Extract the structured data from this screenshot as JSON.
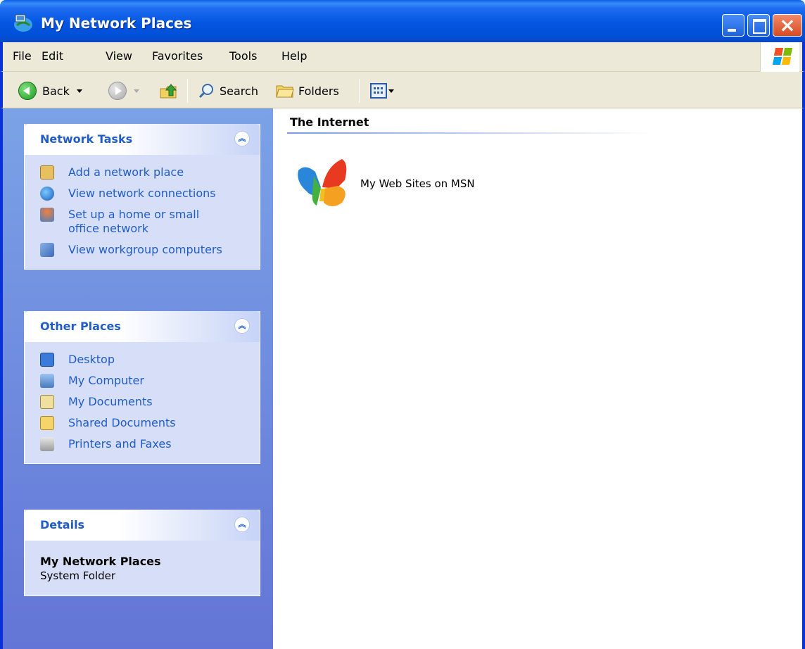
{
  "window": {
    "title": "My Network Places"
  },
  "menu": {
    "items": [
      "File",
      "Edit",
      "View",
      "Favorites",
      "Tools",
      "Help"
    ]
  },
  "toolbar": {
    "back_label": "Back",
    "search_label": "Search",
    "folders_label": "Folders"
  },
  "sidebar": {
    "network_tasks": {
      "title": "Network Tasks",
      "items": [
        {
          "label": "Add a network place",
          "icon": "add-network-place-icon"
        },
        {
          "label": "View network connections",
          "icon": "network-connections-icon"
        },
        {
          "label": "Set up a home or small office network",
          "icon": "home-network-icon"
        },
        {
          "label": "View workgroup computers",
          "icon": "workgroup-icon"
        }
      ]
    },
    "other_places": {
      "title": "Other Places",
      "items": [
        {
          "label": "Desktop",
          "icon": "desktop-icon"
        },
        {
          "label": "My Computer",
          "icon": "my-computer-icon"
        },
        {
          "label": "My Documents",
          "icon": "my-documents-icon"
        },
        {
          "label": "Shared Documents",
          "icon": "shared-documents-icon"
        },
        {
          "label": "Printers and Faxes",
          "icon": "printers-icon"
        }
      ]
    },
    "details": {
      "title": "Details",
      "name": "My Network Places",
      "type": "System Folder"
    }
  },
  "main": {
    "group_title": "The Internet",
    "items": [
      {
        "label": "My Web Sites on MSN",
        "icon": "msn-butterfly-icon"
      }
    ]
  },
  "colors": {
    "titlebar": "#0455e1",
    "link": "#215dc6",
    "pane_top": "#7ba2e7",
    "pane_bottom": "#6375d6"
  }
}
